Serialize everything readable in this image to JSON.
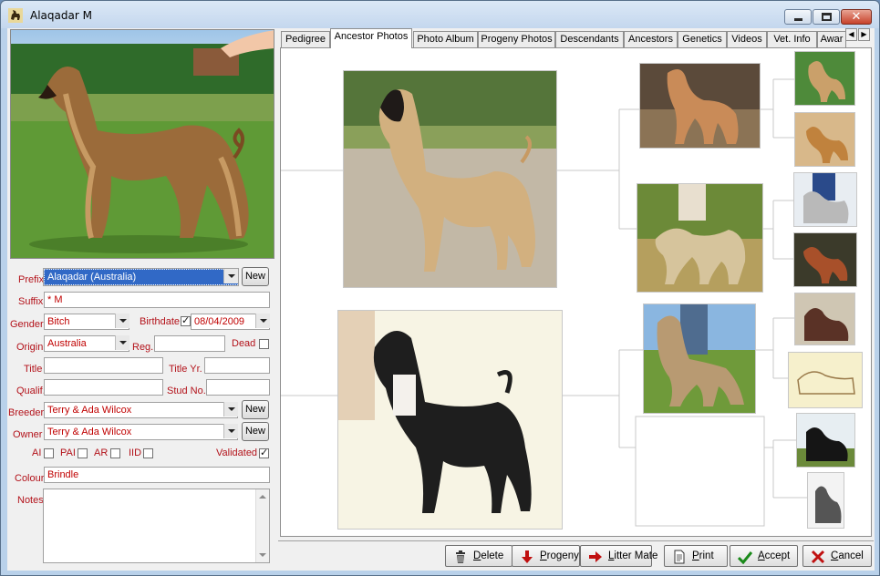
{
  "window": {
    "title": "Alaqadar M"
  },
  "form": {
    "prefix_label": "Prefix",
    "prefix_value": "Alaqadar (Australia)",
    "prefix_new": "New",
    "suffix_label": "Suffix",
    "suffix_value": "* M",
    "gender_label": "Gender",
    "gender_value": "Bitch",
    "birthdate_label": "Birthdate",
    "birthdate_value": "08/04/2009",
    "origin_label": "Origin",
    "origin_value": "Australia",
    "reg_label": "Reg.",
    "reg_value": "",
    "dead_label": "Dead",
    "title_label": "Title",
    "title_value": "",
    "title_yr_label": "Title Yr.",
    "title_yr_value": "",
    "qualif_label": "Qualif.",
    "qualif_value": "",
    "stud_no_label": "Stud No.",
    "stud_no_value": "",
    "breeder_label": "Breeder",
    "breeder_value": "Terry & Ada Wilcox",
    "breeder_new": "New",
    "owner_label": "Owner",
    "owner_value": "Terry & Ada Wilcox",
    "owner_new": "New",
    "ai_label": "AI",
    "pai_label": "PAI",
    "ar_label": "AR",
    "iid_label": "IID",
    "validated_label": "Validated",
    "colour_label": "Colour",
    "colour_value": "Brindle",
    "notes_label": "Notes",
    "notes_value": ""
  },
  "tabs": [
    {
      "label": "Pedigree"
    },
    {
      "label": "Ancestor Photos",
      "active": true
    },
    {
      "label": "Photo Album"
    },
    {
      "label": "Progeny Photos"
    },
    {
      "label": "Descendants"
    },
    {
      "label": "Ancestors"
    },
    {
      "label": "Genetics"
    },
    {
      "label": "Videos"
    },
    {
      "label": "Vet. Info"
    },
    {
      "label": "Awar"
    }
  ],
  "toolbar": {
    "delete": "Delete",
    "progeny": "Progeny",
    "litter_mate": "Litter Mate",
    "print": "Print",
    "accept": "Accept",
    "cancel": "Cancel"
  },
  "icons": {
    "app": "dog-icon",
    "minimize": "minimize-icon",
    "maximize": "maximize-icon",
    "close": "close-icon",
    "delete": "trash-icon",
    "progeny": "down-arrow-icon",
    "litter_mate": "right-arrow-icon",
    "print": "document-icon",
    "accept": "checkmark-icon",
    "cancel": "x-icon"
  },
  "colors": {
    "label_red": "#b3121a",
    "selection_blue": "#3169c6",
    "accept_green": "#1a8a1a",
    "cancel_red": "#c01010"
  }
}
